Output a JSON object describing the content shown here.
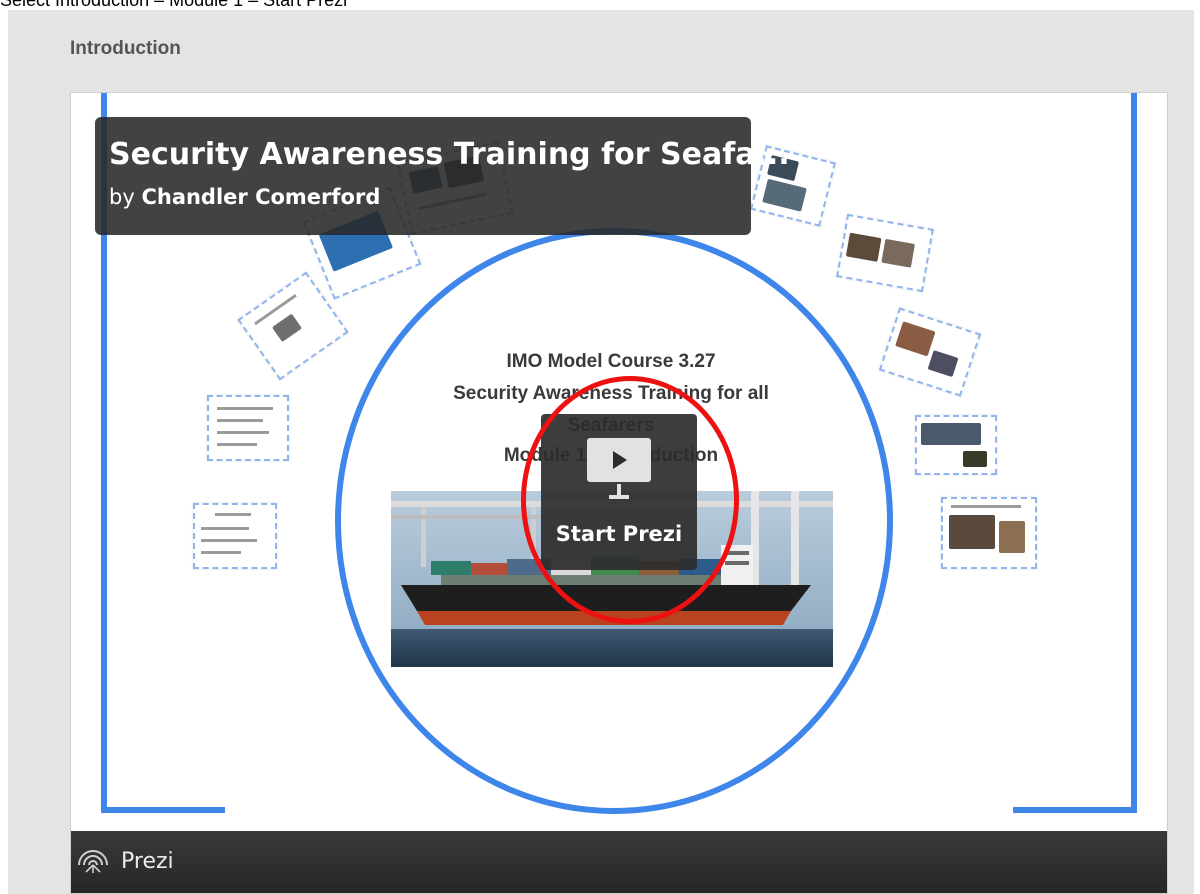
{
  "instruction": "Select Introduction – Module 1 – Start Prezi",
  "section": {
    "title": "Introduction"
  },
  "prezi": {
    "title": "Security Awareness Training for Seafa...",
    "by_prefix": "by",
    "author": "Chandler Comerford",
    "course_lines": [
      "IMO Model Course 3.27",
      "Security Awareness Training for all",
      "Seafarers",
      "Module 1 – Introduction"
    ],
    "start_label": "Start Prezi",
    "footer_brand": "Prezi"
  },
  "colors": {
    "frame": "#3f86ea",
    "highlight": "#ee1111",
    "footer": "#2e2e2e"
  },
  "icons": {
    "play": "play-icon",
    "presenter_stand": "presenter-stand-icon",
    "logo": "prezi-logo-icon"
  }
}
